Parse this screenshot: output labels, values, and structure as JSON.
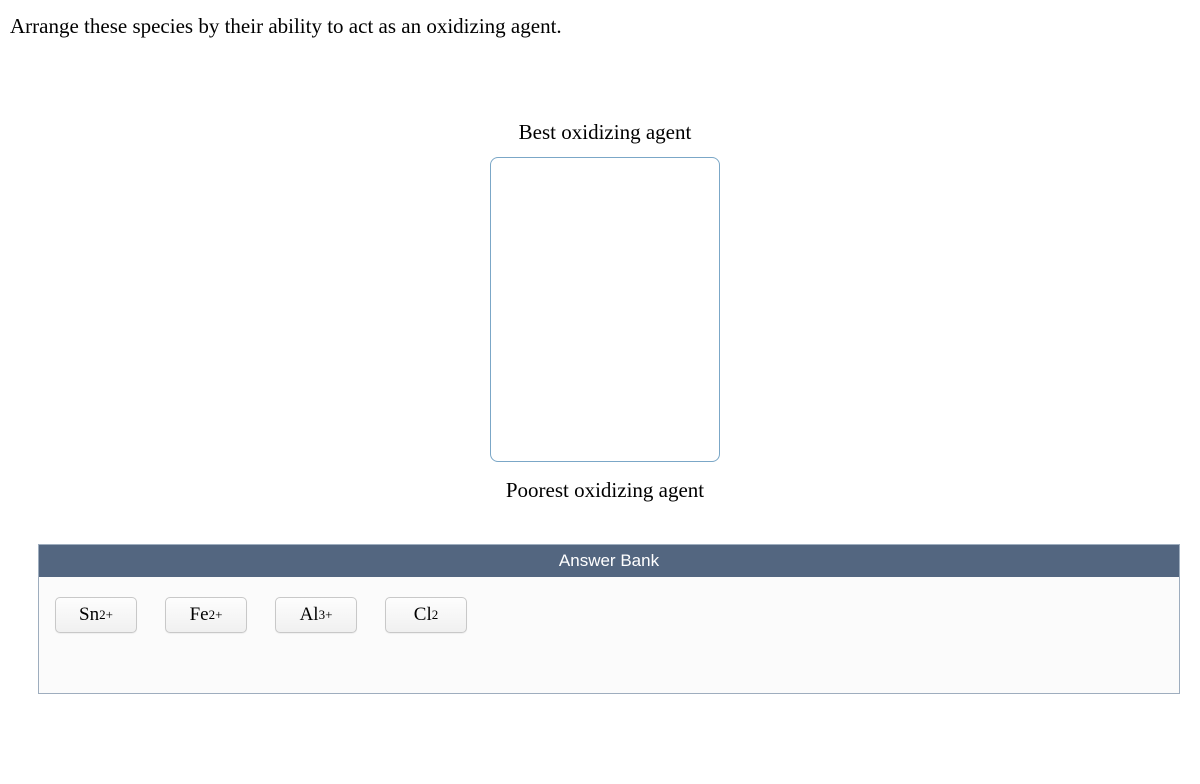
{
  "question": "Arrange these species by their ability to act as an oxidizing agent.",
  "ranking": {
    "topLabel": "Best oxidizing agent",
    "bottomLabel": "Poorest oxidizing agent"
  },
  "answerBank": {
    "header": "Answer Bank",
    "items": [
      {
        "base": "Sn",
        "sup": "2+",
        "sub": ""
      },
      {
        "base": "Fe",
        "sup": "2+",
        "sub": ""
      },
      {
        "base": "Al",
        "sup": "3+",
        "sub": ""
      },
      {
        "base": "Cl",
        "sup": "",
        "sub": "2"
      }
    ]
  }
}
